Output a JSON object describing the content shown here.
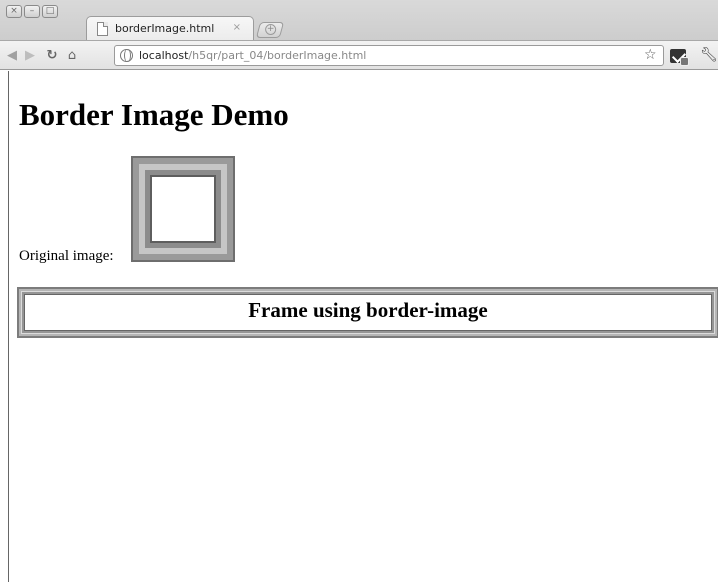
{
  "window": {
    "controls": [
      "×",
      "–",
      "□"
    ]
  },
  "tab": {
    "title": "borderImage.html",
    "close": "×",
    "new_tab": "+"
  },
  "toolbar": {
    "url_host": "localhost",
    "url_path": "/h5qr/part_04/borderImage.html",
    "icons": [
      "back-icon",
      "forward-icon",
      "reload-icon",
      "home-icon",
      "globe-icon",
      "star-icon",
      "extension-icon",
      "wrench-icon"
    ]
  },
  "page": {
    "title": "Border Image Demo",
    "original_label": "Original image:",
    "frame_text": "Frame using border-image"
  }
}
